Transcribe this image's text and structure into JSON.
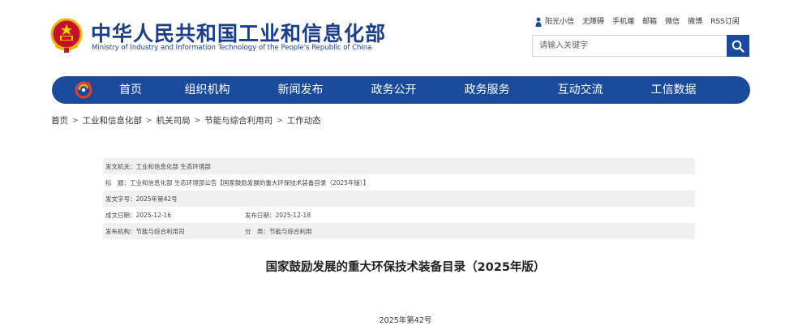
{
  "header": {
    "title": "中华人民共和国工业和信息化部",
    "subtitle": "Ministry of Industry and Information Technology of the People's Republic of China"
  },
  "top_links": [
    "阳光小信",
    "无障碍",
    "手机端",
    "邮箱",
    "微信",
    "微博",
    "RSS订阅"
  ],
  "search": {
    "placeholder": "请输入关键字"
  },
  "nav": {
    "items": [
      "首页",
      "组织机构",
      "新闻发布",
      "政务公开",
      "政务服务",
      "互动交流",
      "工信数据"
    ]
  },
  "breadcrumb": [
    "首页",
    "工业和信息化部",
    "机关司局",
    "节能与综合利用司",
    "工作动态"
  ],
  "breadcrumb_separator": ">",
  "meta": {
    "issuer": "发文机关：工业和信息化部 生态环境部",
    "subject": "标　题：工业和信息化部 生态环境部公告【国家鼓励发展的重大环保技术装备目录（2025年版）】",
    "doc_no": "发文字号：2025年第42号",
    "created": "成文日期：2025-12-16",
    "published": "发布日期：2025-12-18",
    "publisher": "发布机构：节能与综合利用司",
    "category": "分　类：节能与综合利用"
  },
  "article": {
    "title": "国家鼓励发展的重大环保技术装备目录（2025年版）",
    "number": "2025年第42号"
  },
  "colors": {
    "brand_blue": "#1a4a9c",
    "title_blue": "#1a3e8c",
    "meta_shade": "#f0f0f0"
  }
}
